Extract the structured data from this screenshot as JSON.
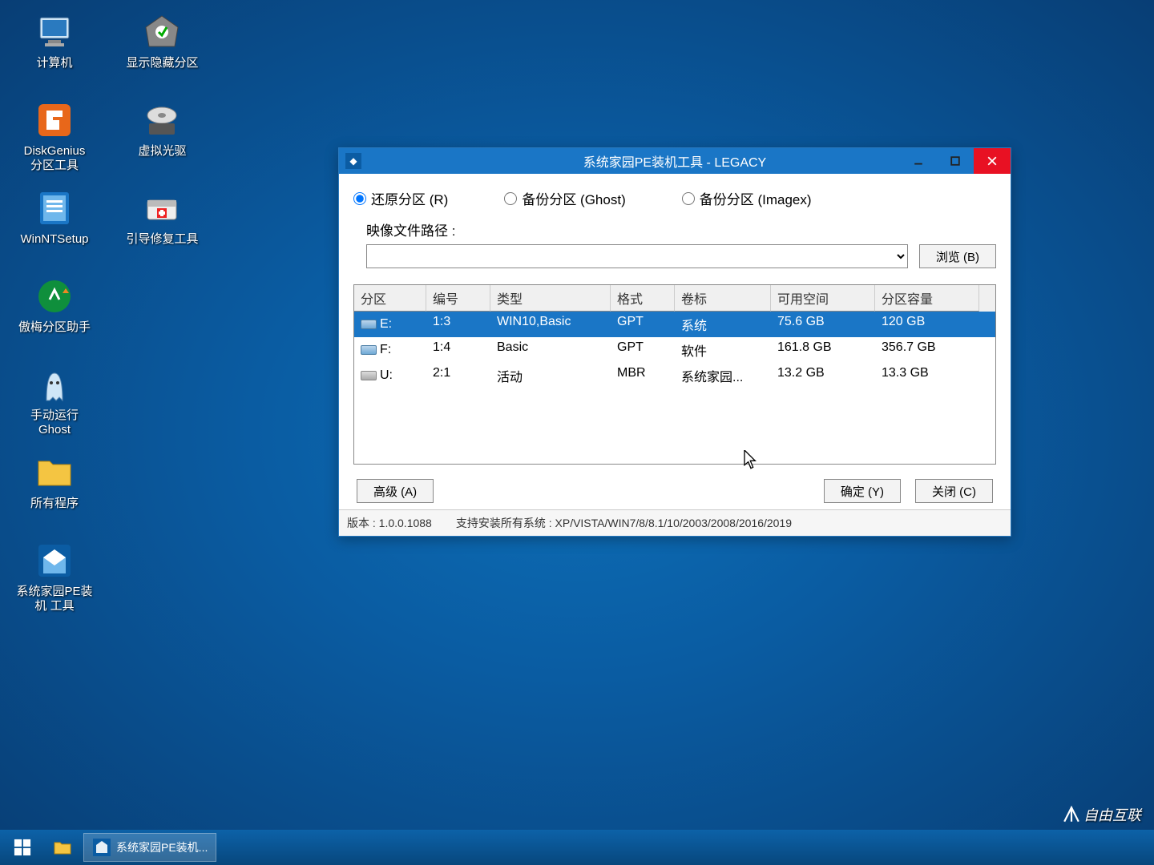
{
  "desktop": {
    "col1": [
      {
        "label": "计算机",
        "icon": "computer"
      },
      {
        "label": "DiskGenius\n分区工具",
        "icon": "diskgenius"
      },
      {
        "label": "WinNTSetup",
        "icon": "winntsetup"
      },
      {
        "label": "傲梅分区助手",
        "icon": "aomei"
      },
      {
        "label": "手动运行\nGhost",
        "icon": "ghost"
      },
      {
        "label": "所有程序",
        "icon": "folder"
      },
      {
        "label": "系统家园PE装\n机 工具",
        "icon": "pe-tool"
      }
    ],
    "col2": [
      {
        "label": "显示隐藏分区",
        "icon": "show-hidden"
      },
      {
        "label": "虚拟光驱",
        "icon": "virtual-cd"
      },
      {
        "label": "引导修复工具",
        "icon": "boot-repair"
      }
    ]
  },
  "window": {
    "title": "系统家园PE装机工具 - LEGACY",
    "radios": {
      "restore": "还原分区 (R)",
      "backup_ghost": "备份分区 (Ghost)",
      "backup_imagex": "备份分区 (Imagex)"
    },
    "path_label": "映像文件路径 :",
    "browse_btn": "浏览 (B)",
    "columns": [
      "分区",
      "编号",
      "类型",
      "格式",
      "卷标",
      "可用空间",
      "分区容量"
    ],
    "rows": [
      {
        "drive": "E:",
        "num": "1:3",
        "type": "WIN10,Basic",
        "format": "GPT",
        "label": "系统",
        "free": "75.6 GB",
        "total": "120 GB",
        "selected": true,
        "ico": "hdd"
      },
      {
        "drive": "F:",
        "num": "1:4",
        "type": "Basic",
        "format": "GPT",
        "label": "软件",
        "free": "161.8 GB",
        "total": "356.7 GB",
        "selected": false,
        "ico": "hdd"
      },
      {
        "drive": "U:",
        "num": "2:1",
        "type": "活动",
        "format": "MBR",
        "label": "系统家园...",
        "free": "13.2 GB",
        "total": "13.3 GB",
        "selected": false,
        "ico": "usb"
      }
    ],
    "advanced_btn": "高级 (A)",
    "ok_btn": "确定 (Y)",
    "close_btn": "关闭 (C)",
    "version": "版本 : 1.0.0.1088",
    "support": "支持安装所有系统 : XP/VISTA/WIN7/8/8.1/10/2003/2008/2016/2019"
  },
  "taskbar": {
    "app": "系统家园PE装机..."
  },
  "watermark": "自由互联"
}
